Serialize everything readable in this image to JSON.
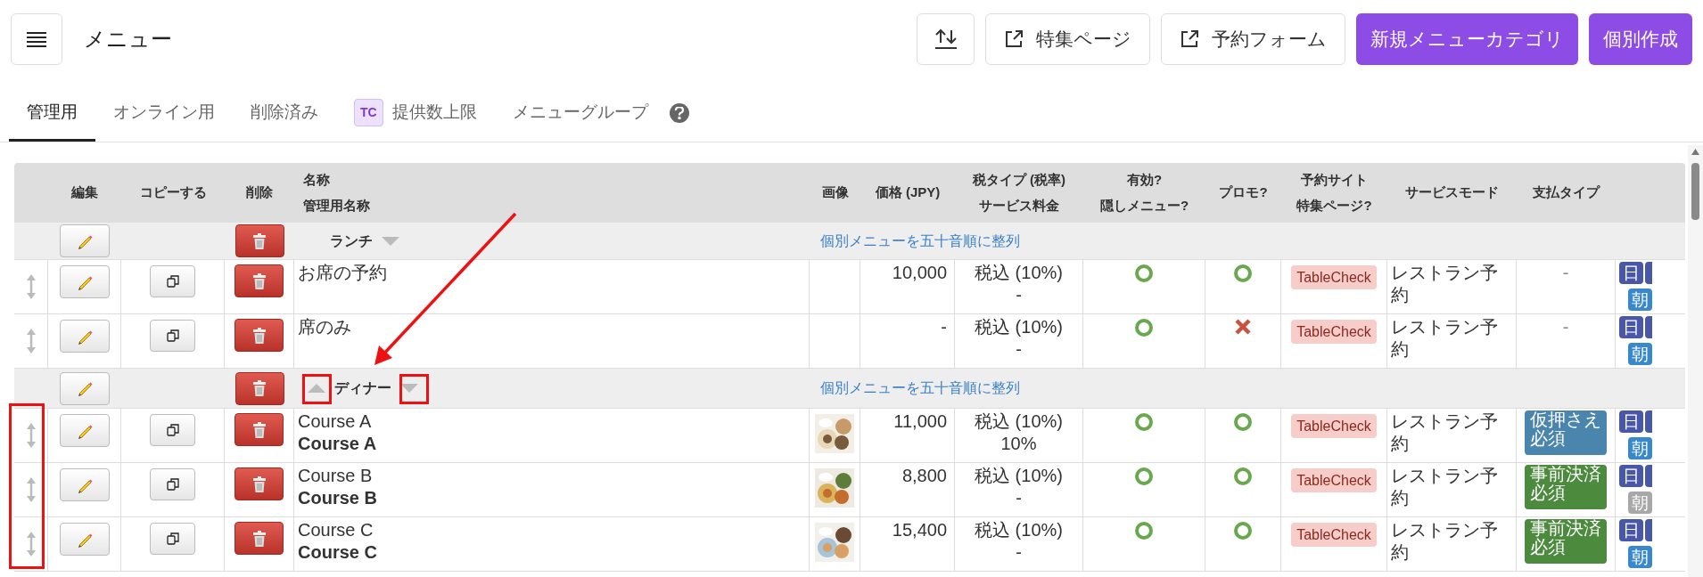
{
  "header": {
    "title": "メニュー",
    "buttons": [
      {
        "kind": "icon"
      },
      {
        "kind": "external",
        "label": "特集ページ"
      },
      {
        "kind": "external",
        "label": "予約フォーム"
      },
      {
        "kind": "primary",
        "label": "新規メニューカテゴリ"
      },
      {
        "kind": "primary",
        "label": "個別作成"
      }
    ]
  },
  "tabs": [
    {
      "label": "管理用",
      "selected": true
    },
    {
      "label": "オンライン用",
      "selected": false
    },
    {
      "label": "削除済み",
      "selected": false
    },
    {
      "label": "提供数上限",
      "badge": "TC",
      "selected": false
    },
    {
      "label": "メニューグループ",
      "selected": false
    }
  ],
  "table": {
    "columns": [
      {
        "lines": [
          "編集"
        ]
      },
      {
        "lines": [
          "コピーする"
        ]
      },
      {
        "lines": [
          "削除"
        ]
      },
      {
        "lines": [
          "名称",
          "管理用名称"
        ]
      },
      {
        "lines": [
          "画像"
        ]
      },
      {
        "lines": [
          "価格 (JPY)"
        ]
      },
      {
        "lines": [
          "税タイプ (税率)",
          "サービス料金"
        ]
      },
      {
        "lines": [
          "有効?",
          "隠しメニュー?"
        ]
      },
      {
        "lines": [
          "プロモ?"
        ]
      },
      {
        "lines": [
          "予約サイト",
          "特集ページ?"
        ]
      },
      {
        "lines": [
          "サービスモード"
        ]
      },
      {
        "lines": [
          "支払タイプ"
        ]
      }
    ],
    "rows": [
      {
        "kind": "category",
        "name": "ランチ",
        "up": false,
        "down": true,
        "sort_link": "個別メニューを五十音順に整列"
      },
      {
        "kind": "item",
        "name": "お席の予約",
        "image": false,
        "price": "10,000",
        "tax": "税込 (10%)",
        "fee": "-",
        "valid": true,
        "promo": true,
        "site": "TableCheck",
        "mode": "レストラン予約",
        "payment": {
          "kind": "none",
          "text": "-"
        },
        "days": [
          {
            "label": "日"
          },
          {
            "label": "朝",
            "active": true
          }
        ]
      },
      {
        "kind": "item",
        "name": "席のみ",
        "image": false,
        "price": "-",
        "tax": "税込 (10%)",
        "fee": "-",
        "valid": true,
        "promo": false,
        "site": "TableCheck",
        "mode": "レストラン予約",
        "payment": {
          "kind": "none",
          "text": "-"
        },
        "days": [
          {
            "label": "日"
          },
          {
            "label": "朝",
            "active": true
          }
        ]
      },
      {
        "kind": "category",
        "name": "ディナー",
        "up": true,
        "down": true,
        "sort_link": "個別メニューを五十音順に整列"
      },
      {
        "kind": "item",
        "name": "Course A",
        "admin_name": "Course A",
        "image": true,
        "price": "11,000",
        "tax": "税込 (10%)",
        "fee": "10%",
        "valid": true,
        "promo": true,
        "site": "TableCheck",
        "mode": "レストラン予約",
        "payment": {
          "kind": "badge",
          "text": "仮押さえ必須",
          "color": "#4a85ad"
        },
        "days": [
          {
            "label": "日"
          },
          {
            "label": "朝",
            "active": true
          }
        ]
      },
      {
        "kind": "item",
        "name": "Course B",
        "admin_name": "Course B",
        "image": true,
        "price": "8,800",
        "tax": "税込 (10%)",
        "fee": "-",
        "valid": true,
        "promo": true,
        "site": "TableCheck",
        "mode": "レストラン予約",
        "payment": {
          "kind": "badge",
          "text": "事前決済必須",
          "color": "#4c8a3e"
        },
        "days": [
          {
            "label": "日"
          },
          {
            "label": "朝",
            "active": false
          }
        ]
      },
      {
        "kind": "item",
        "name": "Course C",
        "admin_name": "Course C",
        "image": true,
        "price": "15,400",
        "tax": "税込 (10%)",
        "fee": "-",
        "valid": true,
        "promo": true,
        "site": "TableCheck",
        "mode": "レストラン予約",
        "payment": {
          "kind": "badge",
          "text": "事前決済必須",
          "color": "#4c8a3e"
        },
        "days": [
          {
            "label": "日"
          },
          {
            "label": "朝",
            "active": true
          }
        ]
      }
    ]
  }
}
